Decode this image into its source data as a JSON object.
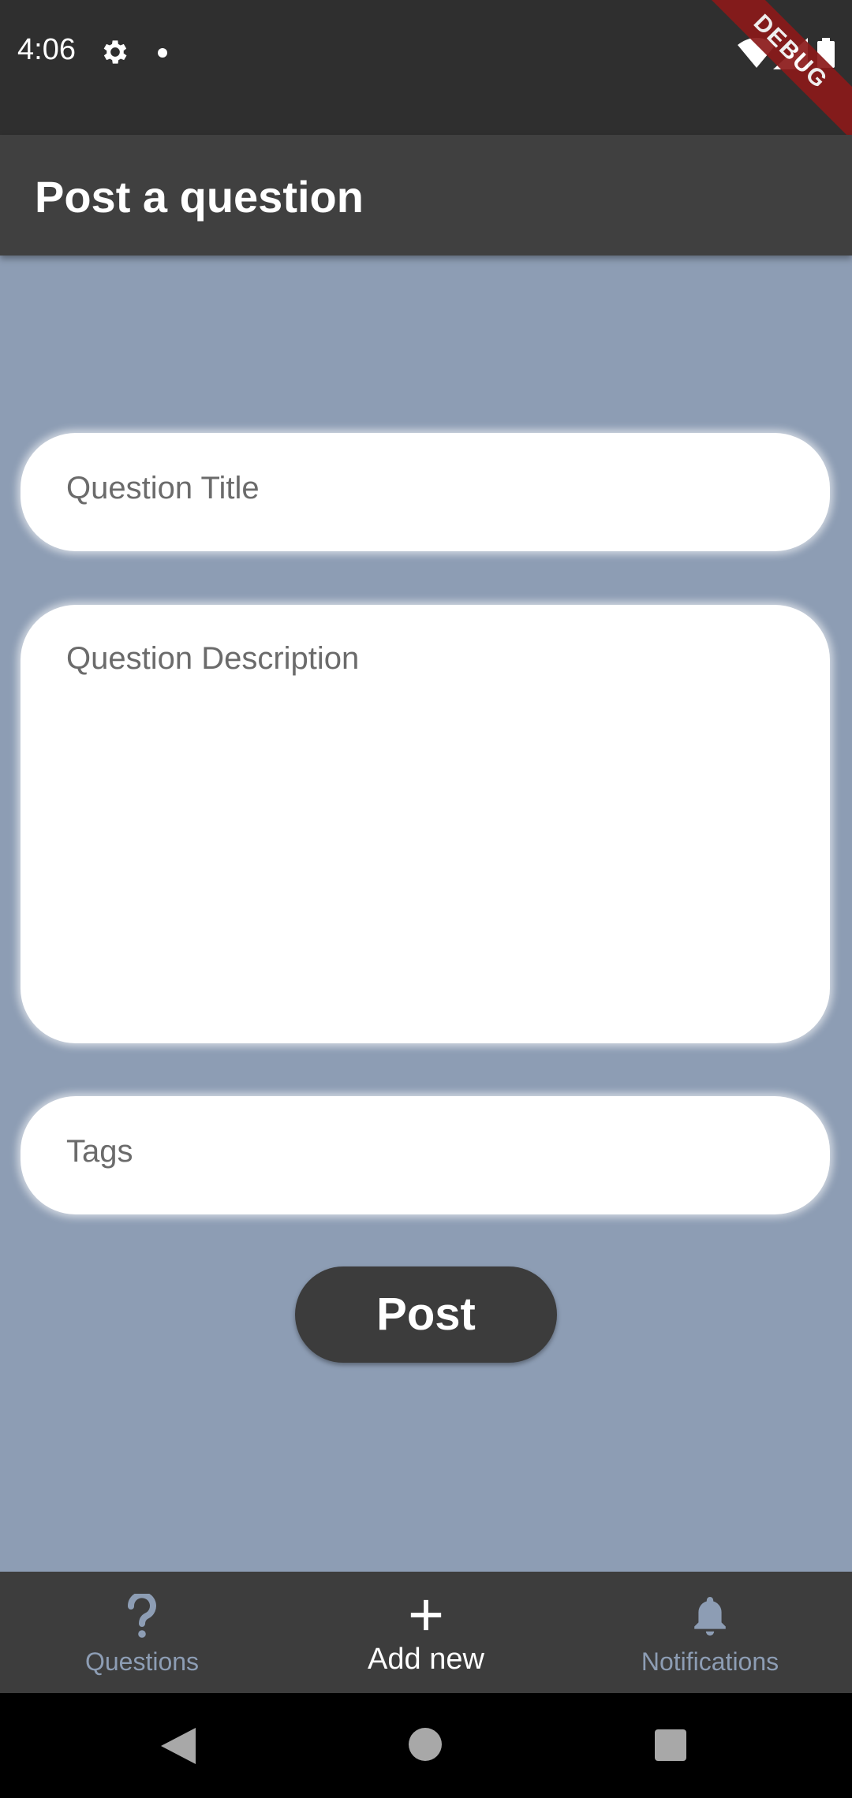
{
  "status_bar": {
    "time": "4:06",
    "debug_label": "DEBUG"
  },
  "app_bar": {
    "title": "Post a question"
  },
  "form": {
    "title_placeholder": "Question Title",
    "description_placeholder": "Question Description",
    "tags_placeholder": "Tags",
    "post_label": "Post"
  },
  "bottom_nav": {
    "items": [
      {
        "label": "Questions",
        "icon": "question-mark-icon",
        "active": false
      },
      {
        "label": "Add new",
        "icon": "plus-icon",
        "active": true
      },
      {
        "label": "Notifications",
        "icon": "bell-icon",
        "active": false
      }
    ]
  },
  "colors": {
    "background": "#8d9db4",
    "app_bar": "#404040",
    "status_bar": "#2f2f2f",
    "button": "#3c3c3c",
    "nav_inactive": "#8d9db4",
    "nav_active": "#ffffff"
  }
}
